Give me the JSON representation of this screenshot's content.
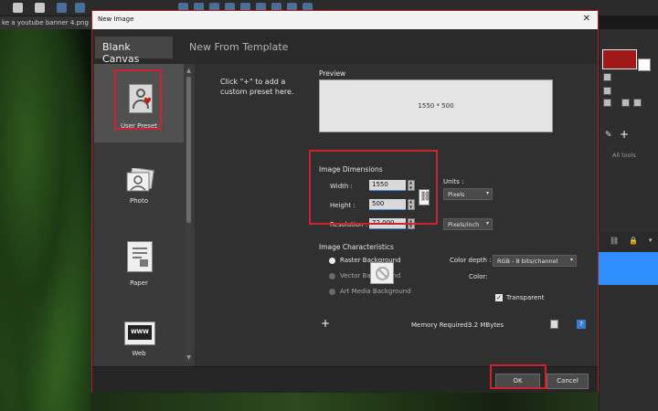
{
  "app": {
    "document_tab": "ke a youtube banner 4.png",
    "panel_label": "All tools"
  },
  "dialog": {
    "title": "New Image",
    "close_glyph": "✕",
    "tabs": [
      {
        "label": "Blank Canvas",
        "active": true
      },
      {
        "label": "New From Template",
        "active": false
      }
    ]
  },
  "presets": [
    {
      "label": "User Preset",
      "selected": true
    },
    {
      "label": "Photo"
    },
    {
      "label": "Paper"
    },
    {
      "label": "Web",
      "icon_text": "WWW"
    }
  ],
  "custom_hint": "Click \"+\" to add a custom preset here.",
  "preview": {
    "label": "Preview",
    "size_text": "1550 * 500"
  },
  "dimensions": {
    "label": "Image Dimensions",
    "width_label": "Width :",
    "width_value": "1550",
    "height_label": "Height :",
    "height_value": "500",
    "resolution_label": "Resolution :",
    "resolution_value": "72.000",
    "units_label": "Units :",
    "units_value": "Pixels",
    "resolution_units_value": "Pixels/inch"
  },
  "characteristics": {
    "label": "Image Characteristics",
    "options": [
      {
        "label": "Raster Background",
        "selected": true
      },
      {
        "label": "Vector Background",
        "selected": false
      },
      {
        "label": "Art Media Background",
        "selected": false
      }
    ],
    "color_depth_label": "Color depth :",
    "color_depth_value": "RGB - 8 bits/channel",
    "color_label": "Color:",
    "transparent_label": "Transparent",
    "transparent_checked": true
  },
  "memory": {
    "label": "Memory Required:",
    "value": "3.2 MBytes"
  },
  "buttons": {
    "add": "+",
    "help": "?",
    "ok": "OK",
    "cancel": "Cancel"
  },
  "colors": {
    "accent_red": "#d0222a",
    "foreground_color": "#a11818",
    "selection_blue": "#2f8fff"
  }
}
